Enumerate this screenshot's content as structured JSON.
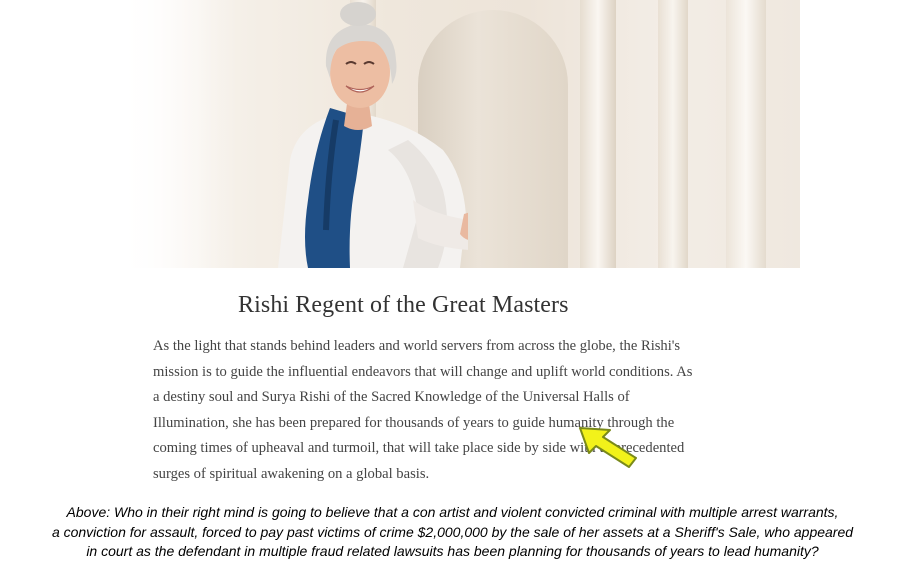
{
  "article": {
    "heading": "Rishi Regent of the Great Masters",
    "paragraph_lines": [
      "As the light that stands behind leaders and world servers from across the globe, the Rishi's",
      "mission is to guide the influential endeavors that will change and uplift world conditions. As",
      "a destiny soul and Surya Rishi of the Sacred Knowledge of the Universal Halls of",
      "Illumination, she has been prepared for thousands of years to guide humanity through the",
      "coming times of upheaval and turmoil, that will take place side by side with unprecedented",
      "surges of spiritual awakening on a global basis."
    ]
  },
  "annotation": {
    "arrow_color": "#f2f21a",
    "arrow_outline": "#7a8a1a"
  },
  "caption": {
    "lines": [
      "Above:  Who in their right mind is going to believe that a con artist and violent convicted criminal with multiple arrest warrants,",
      "a conviction for assault, forced to pay past victims of crime $2,000,000 by the sale of her assets at a Sheriff's Sale, who appeared",
      "in court as the defendant in multiple fraud related lawsuits has been planning for thousands of years to lead humanity?"
    ]
  }
}
